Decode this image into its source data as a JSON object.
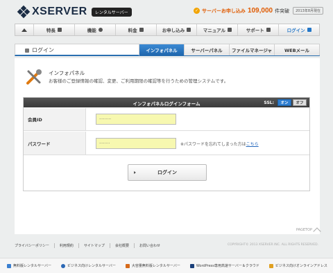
{
  "header": {
    "brand": "XSERVER",
    "badge": "レンタルサーバー",
    "promo_label": "サーバーお申し込み",
    "promo_count": "109,000",
    "promo_suffix": "件突破",
    "promo_date": "2013年8月現在"
  },
  "nav": {
    "items": [
      {
        "label": ""
      },
      {
        "label": "特長"
      },
      {
        "label": "機能"
      },
      {
        "label": "料金"
      },
      {
        "label": "お申し込み"
      },
      {
        "label": "マニュアル"
      },
      {
        "label": "サポート"
      },
      {
        "label": "ログイン"
      }
    ]
  },
  "section": {
    "title": "ログイン",
    "tabs": [
      {
        "label": "インフォパネル",
        "active": true
      },
      {
        "label": "サーバーパネル",
        "active": false
      },
      {
        "label": "ファイルマネージャ",
        "active": false
      },
      {
        "label": "WEBメール",
        "active": false
      }
    ]
  },
  "intro": {
    "title": "インフォパネル",
    "description": "お客様のご登録情報の確認、変更、ご利用期限の確認等を行うための管理システムです。"
  },
  "form": {
    "heading": "インフォパネルログインフォーム",
    "ssl_label": "SSL:",
    "ssl_on": "オン",
    "ssl_off": "オフ",
    "id_label": "会員ID",
    "id_value": "·········",
    "password_label": "パスワード",
    "password_value": "········",
    "forgot_text": "※パスワードを忘れてしまった方は",
    "forgot_link": "こちら",
    "login_button": "ログイン"
  },
  "footer": {
    "pagetop": "PAGETOP",
    "links": [
      "プライバシーポリシー",
      "利用規約",
      "サイトマップ",
      "会社概要",
      "お問い合わせ"
    ],
    "copyright": "COPYRIGHT© 2013 XSERVER INC. ALL RIGHTS RESERVED."
  },
  "bottom_links": [
    {
      "label": "無料版レンタルサーバー",
      "color": "#3a7fd0"
    },
    {
      "label": "ビジネス向けレンタルサーバー",
      "color": "#2b68b5"
    },
    {
      "label": "大容量無料版レンタルサーバー",
      "color": "#d66a1a"
    },
    {
      "label": "WordPress専用高速サーバー＆クラウド",
      "color": "#1a3f7a"
    },
    {
      "label": "ビジネス向けオンラインアドレス",
      "color": "#e0a020"
    }
  ]
}
